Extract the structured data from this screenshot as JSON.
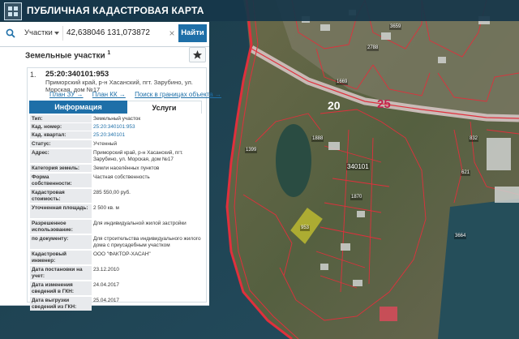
{
  "header": {
    "title": "ПУБЛИЧНАЯ КАДАСТРОВАЯ КАРТА"
  },
  "search": {
    "type_selected": "Участки",
    "query": "42,638046 131,073872",
    "clear_icon": "close-icon",
    "find_label": "Найти"
  },
  "panel": {
    "section_title": "Земельные участки",
    "section_sup": "1",
    "record": {
      "number": "1.",
      "cadastral_id": "25:20:340101:953",
      "address": "Приморский край, р-н Хасанский, пгт. Зарубино, ул. Морская, дом №17",
      "links": [
        "План ЗУ →",
        "План КК →",
        "Поиск в границах объекта →"
      ]
    },
    "tabs": [
      {
        "label": "Информация",
        "active": true
      },
      {
        "label": "Услуги",
        "active": false
      }
    ],
    "rows": [
      {
        "label": "Тип:",
        "value": "Земельный участок"
      },
      {
        "label": "Кад. номер:",
        "value": "25:20:340101:953",
        "link": true
      },
      {
        "label": "Кад. квартал:",
        "value": "25:20:340101",
        "link": true
      },
      {
        "label": "Статус:",
        "value": "Учтенный"
      },
      {
        "label": "Адрес:",
        "value": "Приморский край, р-н Хасанский, пгт. Зарубино, ул. Морская, дом №17"
      },
      {
        "label": "Категория земель:",
        "value": "Земли населённых пунктов"
      },
      {
        "label": "Форма собственности:",
        "value": "Частная собственность"
      },
      {
        "label": "Кадастровая стоимость:",
        "value": "285 550,00 руб."
      },
      {
        "label": "Уточненная площадь:",
        "value": "2 500 кв. м"
      },
      {
        "label": "Разрешенное использование:",
        "value": "Для индивидуальной жилой застройки"
      },
      {
        "label": "по документу:",
        "value": "Для строительства индивидуального жилого дома с приусадебным участком"
      },
      {
        "label": "Кадастровый инженер:",
        "value": "ООО \"ФАКТОР-ХАСАН\""
      },
      {
        "label": "Дата постановки на учет:",
        "value": "23.12.2010"
      },
      {
        "label": "Дата изменения сведений в ГКН:",
        "value": "24.04.2017"
      },
      {
        "label": "Дата выгрузки сведений из ГКН:",
        "value": "25.04.2017"
      }
    ]
  },
  "map": {
    "quarter_label": "340101",
    "zone_labels": [
      "20",
      "25"
    ],
    "parcel_label": "953",
    "lot_labels": [
      "1399",
      "2788",
      "1669",
      "3659",
      "832",
      "621",
      "3664",
      "1870",
      "1888"
    ],
    "colors": {
      "water": "#1f4556",
      "land": "#5f6a48",
      "boundary": "#e0303c",
      "selected_parcel": "#e6df2a"
    }
  }
}
